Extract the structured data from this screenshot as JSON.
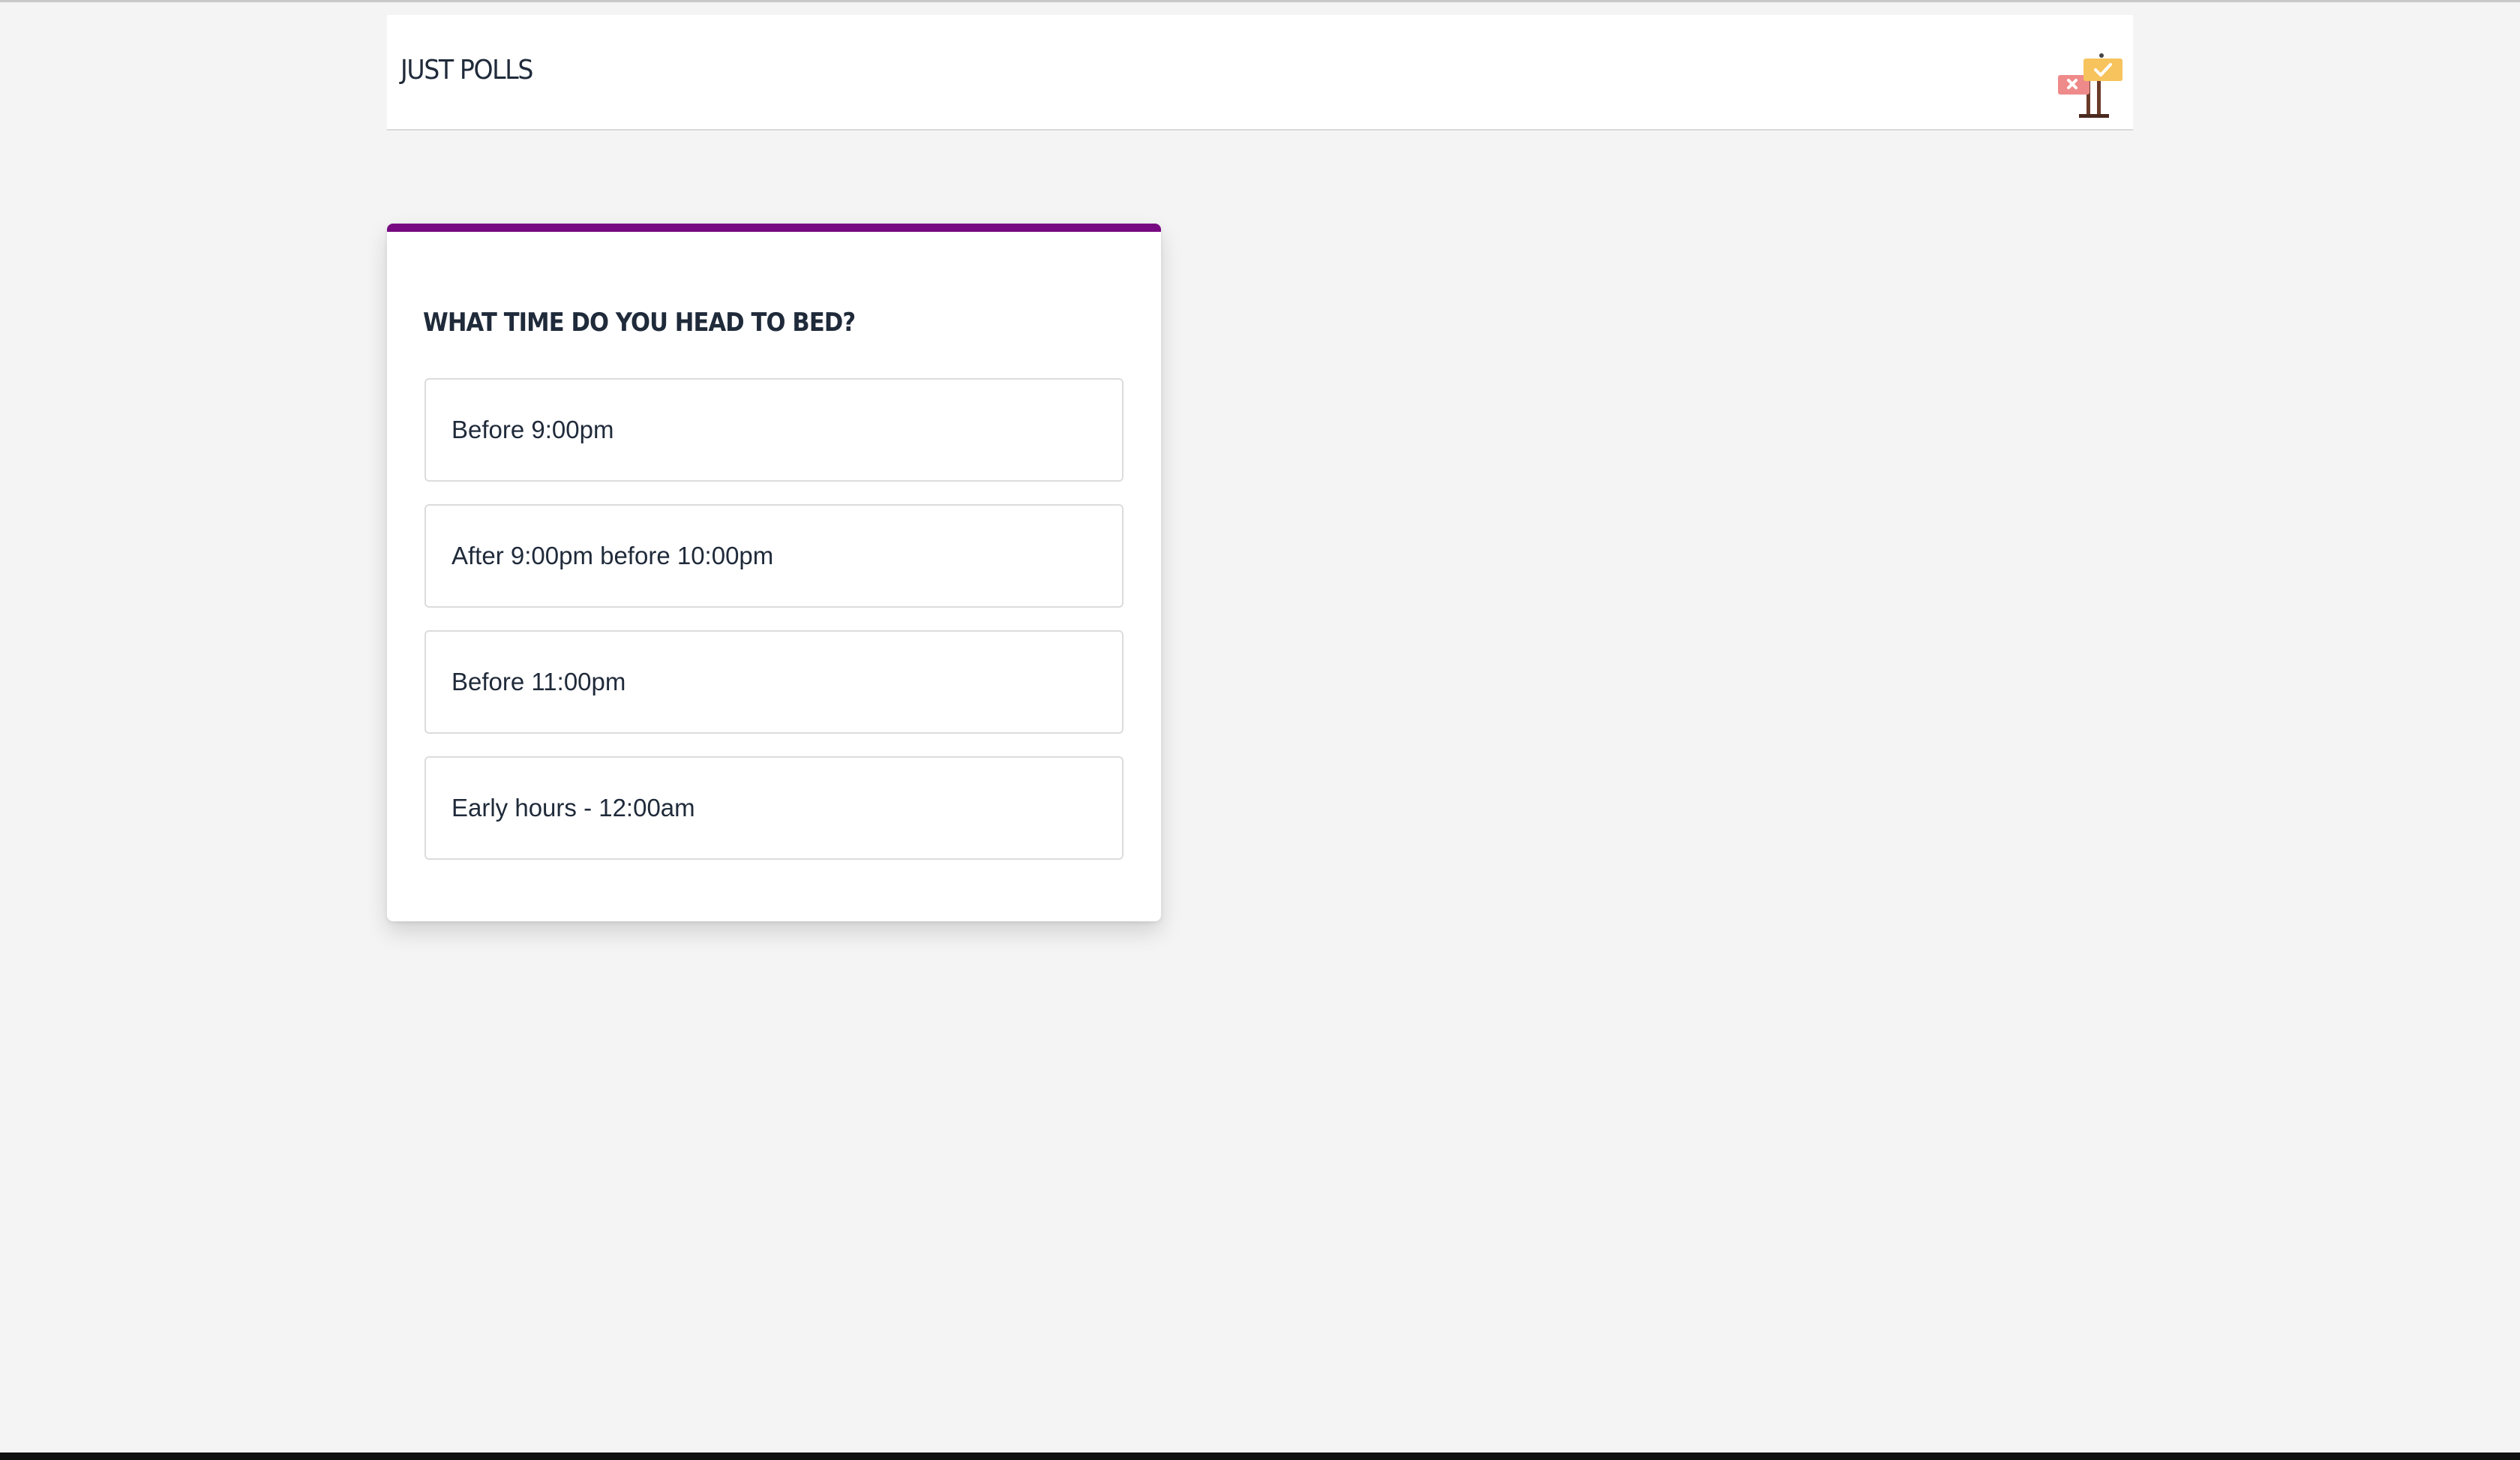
{
  "header": {
    "brand": "JUST POLLS",
    "logo_icon": "poll-signpost-icon"
  },
  "poll": {
    "question": "WHAT TIME DO YOU HEAD TO BED?",
    "accent_color": "#770a80",
    "options": [
      {
        "label": "Before 9:00pm"
      },
      {
        "label": "After 9:00pm before 10:00pm"
      },
      {
        "label": "Before 11:00pm"
      },
      {
        "label": "Early hours - 12:00am"
      }
    ]
  }
}
